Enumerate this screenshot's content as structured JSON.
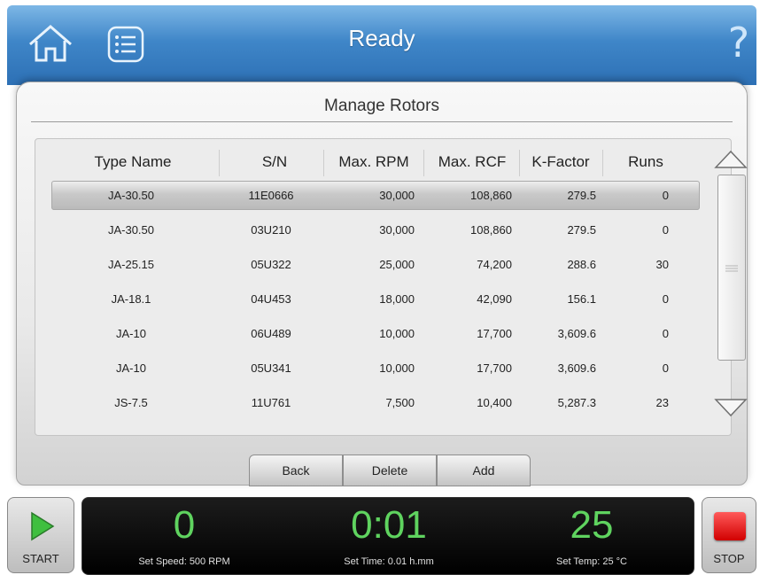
{
  "header": {
    "status": "Ready",
    "help_label": "?"
  },
  "panel": {
    "title": "Manage Rotors"
  },
  "table": {
    "columns": [
      "Type Name",
      "S/N",
      "Max. RPM",
      "Max. RCF",
      "K-Factor",
      "Runs"
    ],
    "rows": [
      {
        "type_name": "JA-30.50",
        "sn": "11E0666",
        "max_rpm": "30,000",
        "max_rcf": "108,860",
        "k_factor": "279.5",
        "runs": "0"
      },
      {
        "type_name": "JA-30.50",
        "sn": "03U210",
        "max_rpm": "30,000",
        "max_rcf": "108,860",
        "k_factor": "279.5",
        "runs": "0"
      },
      {
        "type_name": "JA-25.15",
        "sn": "05U322",
        "max_rpm": "25,000",
        "max_rcf": "74,200",
        "k_factor": "288.6",
        "runs": "30"
      },
      {
        "type_name": "JA-18.1",
        "sn": "04U453",
        "max_rpm": "18,000",
        "max_rcf": "42,090",
        "k_factor": "156.1",
        "runs": "0"
      },
      {
        "type_name": "JA-10",
        "sn": "06U489",
        "max_rpm": "10,000",
        "max_rcf": "17,700",
        "k_factor": "3,609.6",
        "runs": "0"
      },
      {
        "type_name": "JA-10",
        "sn": "05U341",
        "max_rpm": "10,000",
        "max_rcf": "17,700",
        "k_factor": "3,609.6",
        "runs": "0"
      },
      {
        "type_name": "JS-7.5",
        "sn": "11U761",
        "max_rpm": "7,500",
        "max_rcf": "10,400",
        "k_factor": "5,287.3",
        "runs": "23"
      }
    ]
  },
  "actions": {
    "back": "Back",
    "delete": "Delete",
    "add": "Add"
  },
  "footer": {
    "start_label": "START",
    "stop_label": "STOP",
    "speed_value": "0",
    "speed_set": "Set Speed: 500 RPM",
    "time_value": "0:01",
    "time_set": "Set Time: 0.01 h.mm",
    "temp_value": "25",
    "temp_set": "Set Temp: 25 °C"
  },
  "colors": {
    "header_blue": "#3f86c8",
    "display_green": "#5fd35f",
    "stop_red": "#e01010",
    "start_green": "#3fbf3f"
  },
  "icons": [
    "home-icon",
    "list-menu-icon",
    "help-icon",
    "scroll-up-icon",
    "scroll-down-icon",
    "play-icon",
    "stop-square-icon"
  ]
}
